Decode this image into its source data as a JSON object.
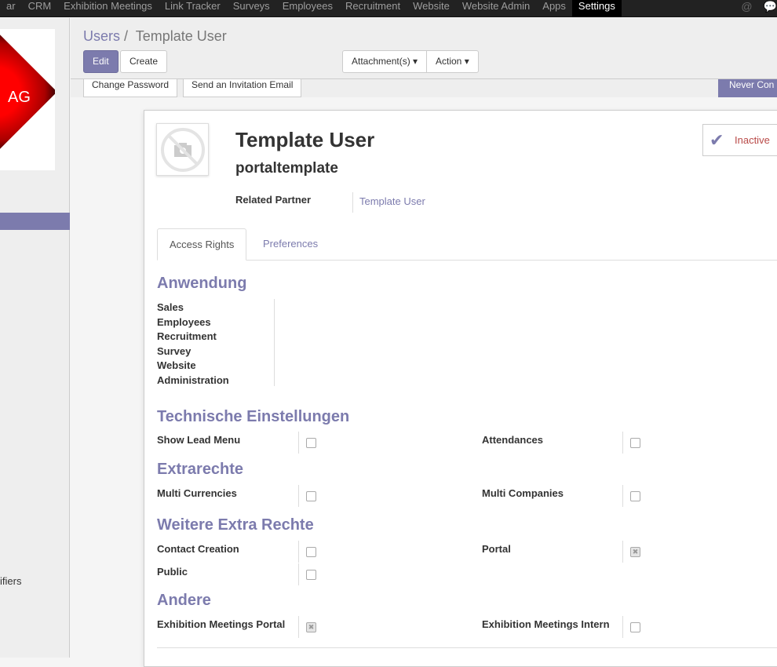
{
  "topnav": {
    "items": [
      "ar",
      "CRM",
      "Exhibition Meetings",
      "Link Tracker",
      "Surveys",
      "Employees",
      "Recruitment",
      "Website",
      "Website Admin",
      "Apps",
      "Settings"
    ],
    "active": "Settings",
    "icons": [
      "at-icon",
      "chat-icon"
    ]
  },
  "sidebar": {
    "logo_text": "AG",
    "partial_item": "ifiers"
  },
  "breadcrumb": {
    "parent": "Users",
    "sep": "/",
    "current": "Template User"
  },
  "buttons": {
    "edit": "Edit",
    "create": "Create",
    "attachments": "Attachment(s)",
    "action": "Action"
  },
  "statusbar": {
    "change_password": "Change Password",
    "send_invitation": "Send an Invitation Email",
    "status": "Never Con"
  },
  "form": {
    "name": "Template User",
    "login": "portaltemplate",
    "active_toggle": "Inactive",
    "related_partner_label": "Related Partner",
    "related_partner": "Template User",
    "tabs": [
      "Access Rights",
      "Preferences"
    ],
    "anwendung": {
      "title": "Anwendung",
      "items": [
        "Sales",
        "Employees",
        "Recruitment",
        "Survey",
        "Website",
        "Administration"
      ]
    },
    "technische": {
      "title": "Technische Einstellungen",
      "fields": [
        {
          "label": "Show Lead Menu",
          "checked": false
        },
        {
          "label": "Attendances",
          "checked": false
        }
      ]
    },
    "extrarechte": {
      "title": "Extrarechte",
      "fields": [
        {
          "label": "Multi Currencies",
          "checked": false
        },
        {
          "label": "Multi Companies",
          "checked": false
        }
      ]
    },
    "weitere": {
      "title": "Weitere Extra Rechte",
      "fields": [
        {
          "label": "Contact Creation",
          "checked": false
        },
        {
          "label": "Portal",
          "checked": true
        },
        {
          "label": "Public",
          "checked": false
        }
      ]
    },
    "andere": {
      "title": "Andere",
      "fields": [
        {
          "label": "Exhibition Meetings Portal",
          "checked": true
        },
        {
          "label": "Exhibition Meetings Intern",
          "checked": false
        }
      ]
    }
  },
  "colors": {
    "accent": "#7c7bad",
    "navbar": "#222222",
    "inactive": "#b94a48"
  }
}
